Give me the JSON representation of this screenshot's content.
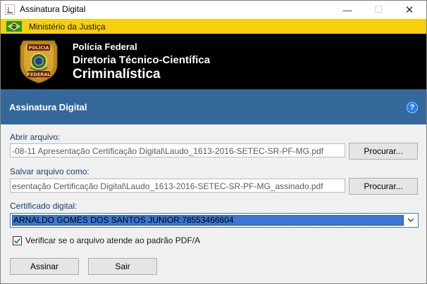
{
  "window": {
    "title": "Assinatura Digital",
    "close_glyph": "✕",
    "minimize_glyph": "—",
    "maximize_glyph": "☐"
  },
  "gov_bar": {
    "label": "Ministério da Justiça",
    "flag_icon": "brazil-flag-icon"
  },
  "header": {
    "badge_icon": "policia-federal-badge-icon",
    "badge_text_top": "POLÍCIA",
    "badge_text_bottom": "FEDERAL",
    "line1": "Polícia Federal",
    "line2": "Diretoria Técnico-Científica",
    "line3": "Criminalística"
  },
  "section": {
    "title": "Assinatura Digital",
    "help_icon": "?"
  },
  "form": {
    "open_label": "Abrir arquivo:",
    "open_value": "-08-11 Apresentação Certificação Digital\\Laudo_1613-2016-SETEC-SR-PF-MG.pdf",
    "open_button": "Procurar...",
    "save_label": "Salvar arquivo como:",
    "save_value": "esentação Certificação Digital\\Laudo_1613-2016-SETEC-SR-PF-MG_assinado.pdf",
    "save_button": "Procurar...",
    "cert_label": "Certificado digital:",
    "cert_value": "ARNALDO GOMES DOS SANTOS JUNIOR:78553466604",
    "pdfa_checked": true,
    "pdfa_label": "Verificar se o arquivo atende ao padrão PDF/A"
  },
  "actions": {
    "sign_button": "Assinar",
    "exit_button": "Sair"
  },
  "colors": {
    "gov_bar": "#f7cf0c",
    "header_bg": "#000000",
    "section_bar": "#35689a",
    "select_highlight": "#3a77d6"
  }
}
